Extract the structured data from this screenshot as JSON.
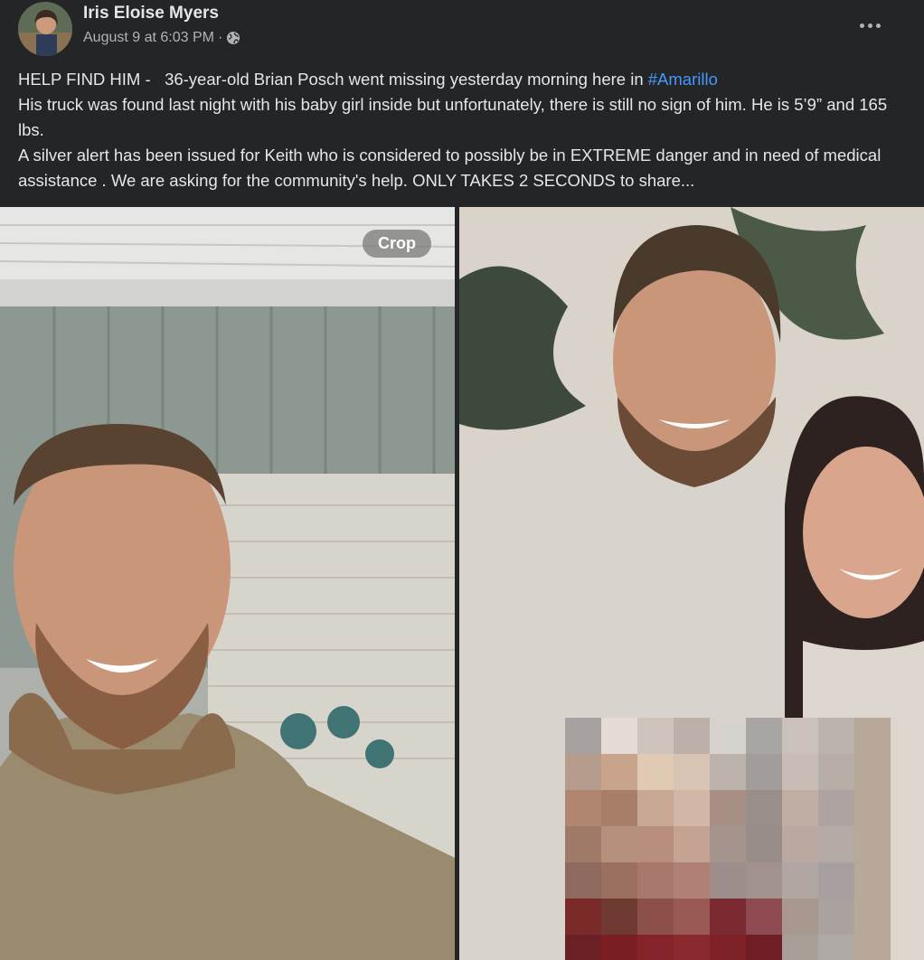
{
  "post": {
    "author": "Iris Eloise Myers",
    "date": "August 9 at 6:03 PM",
    "separator": "·",
    "privacy_icon": "globe-icon",
    "more_icon": "more-horizontal-icon",
    "text_line1_prefix": "HELP FIND HIM -   36-year-old Brian Posch went missing yesterday morning here in ",
    "hashtag": "#Amarillo",
    "text_line2": "His truck was found last night with his baby girl inside but unfortunately, there is still no sign of him. He is 5’9” and 165 lbs.",
    "text_line3": "A silver alert has been issued for Keith who is considered to possibly be in EXTREME danger and in need of medical assistance . We are asking for the community's help. ONLY TAKES 2 SECONDS to share..."
  },
  "photos": {
    "crop_label": "Crop"
  },
  "colors": {
    "background": "#242526",
    "text": "#e4e6eb",
    "secondary_text": "#b0b3b8",
    "link": "#4599ff"
  }
}
